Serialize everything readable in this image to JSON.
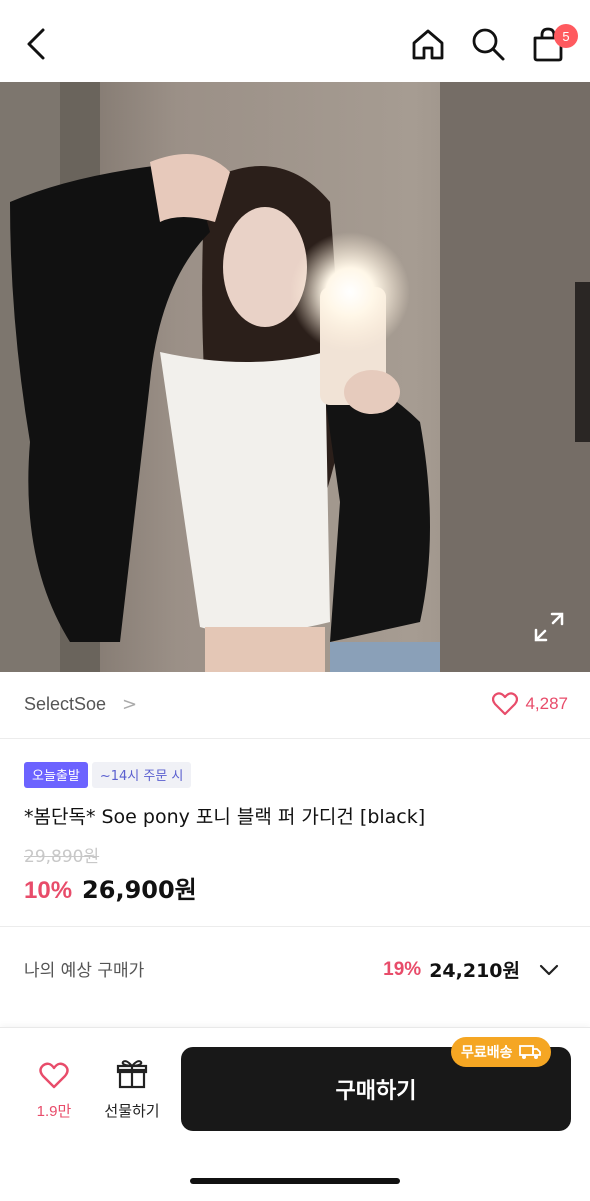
{
  "header": {
    "cart_count": "5",
    "icons": [
      "chevron-left-icon",
      "home-icon",
      "search-icon",
      "bag-icon"
    ]
  },
  "product": {
    "brand": "SelectSoe",
    "brand_chevron": ">",
    "likes": "4,287",
    "badge_today": "오늘출발",
    "badge_time": "~14시 주문 시",
    "title": "*봄단독* Soe pony 포니 블랙 퍼 가디건 [black]",
    "original_price": "29,890원",
    "discount": "10%",
    "price": "26,900원"
  },
  "expected": {
    "label": "나의 예상 구매가",
    "discount": "19%",
    "price": "24,210원"
  },
  "bottom": {
    "wish_count": "1.9만",
    "gift_label": "선물하기",
    "buy_label": "구매하기",
    "free_shipping": "무료배송"
  },
  "colors": {
    "accent_pink": "#e84c6a",
    "badge_purple": "#6c63ff",
    "buy_button": "#181818",
    "free_ship_orange": "#f5a623"
  }
}
